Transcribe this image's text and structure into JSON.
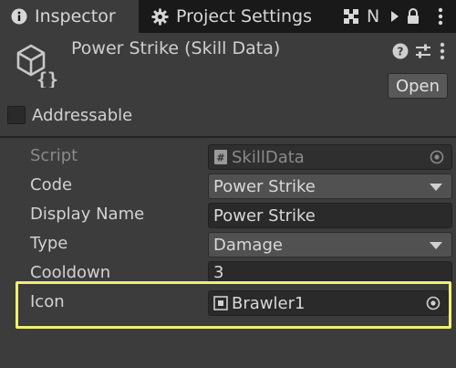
{
  "tabs": [
    {
      "label": "Inspector",
      "icon": "info-icon",
      "active": true
    },
    {
      "label": "Project Settings",
      "icon": "gear-icon",
      "active": false
    },
    {
      "label": "N",
      "icon": "grid-icon",
      "active": false
    }
  ],
  "tabbar_icons": [
    "play-icon",
    "lock-icon",
    "more-vertical-icon"
  ],
  "asset": {
    "title": "Power Strike (Skill Data)",
    "icon": "scriptable-object-icon",
    "header_icons": [
      "help-icon",
      "settings-sliders-icon",
      "more-vertical-icon"
    ],
    "open_label": "Open",
    "addressable_label": "Addressable",
    "addressable_checked": false
  },
  "properties": {
    "script": {
      "label": "Script",
      "value": "SkillData",
      "icon": "script-icon"
    },
    "code": {
      "label": "Code",
      "value": "Power Strike"
    },
    "display_name": {
      "label": "Display Name",
      "value": "Power Strike"
    },
    "type": {
      "label": "Type",
      "value": "Damage"
    },
    "cooldown": {
      "label": "Cooldown",
      "value": "3"
    },
    "icon": {
      "label": "Icon",
      "value": "Brawler1",
      "icon": "sprite-icon"
    }
  },
  "colors": {
    "background": "#3c3c3c",
    "tabbar": "#191919",
    "field": "#2a2a2a",
    "dropdown": "#515151",
    "highlight": "#f0ef72"
  }
}
